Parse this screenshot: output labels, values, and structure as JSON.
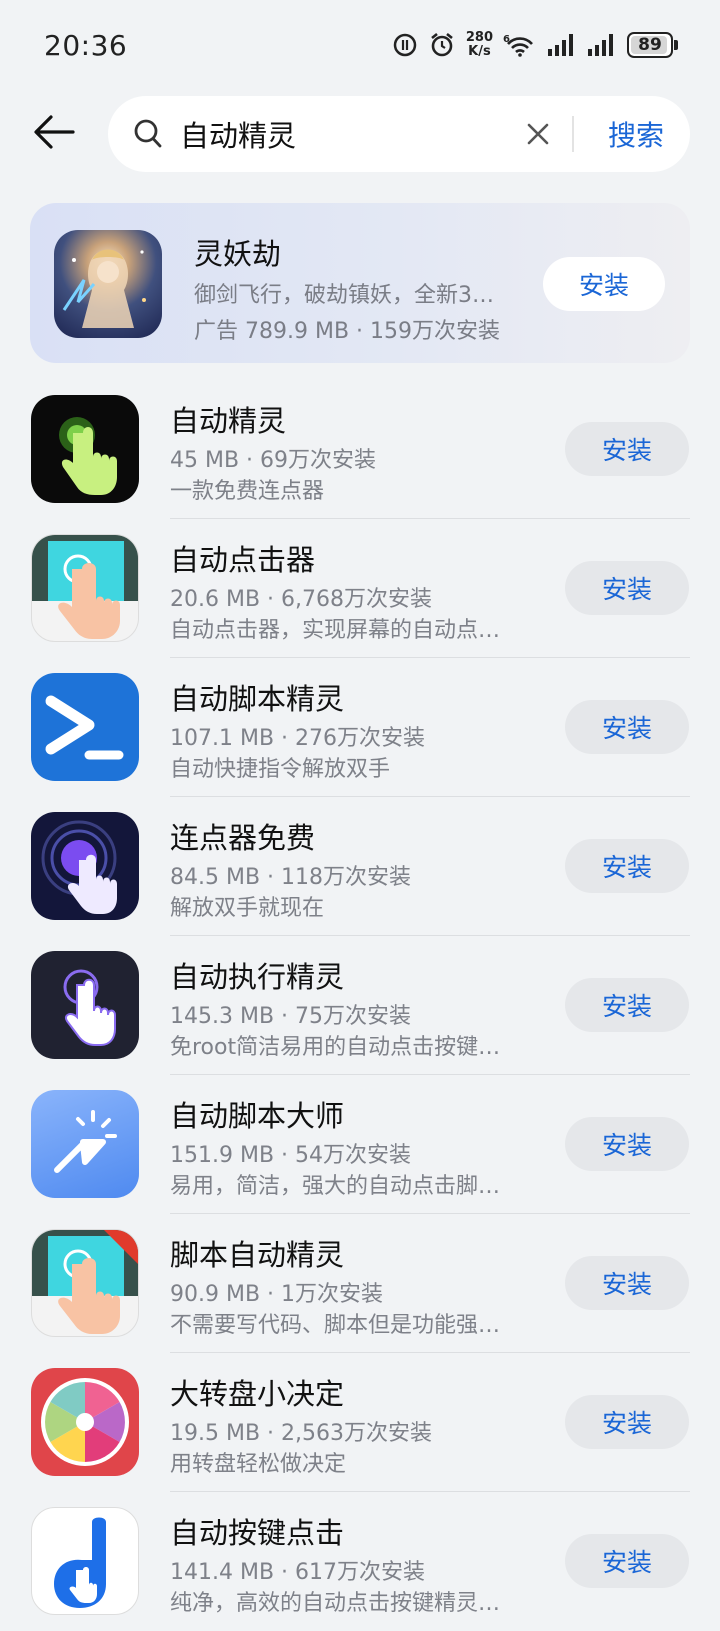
{
  "status_bar": {
    "time": "20:36",
    "net_speed_value": "280",
    "net_speed_unit": "K/s",
    "battery": "89"
  },
  "search": {
    "query": "自动精灵",
    "button_label": "搜索"
  },
  "ad": {
    "title": "灵妖劫",
    "description": "御剑飞行，破劫镇妖，全新3…",
    "meta": "广告 789.9 MB · 159万次安装",
    "install_label": "安装"
  },
  "apps": [
    {
      "name": "自动精灵",
      "meta": "45 MB · 69万次安装",
      "desc": "一款免费连点器",
      "install_label": "安装"
    },
    {
      "name": "自动点击器",
      "meta": "20.6 MB · 6,768万次安装",
      "desc": "自动点击器，实现屏幕的自动点…",
      "install_label": "安装"
    },
    {
      "name": "自动脚本精灵",
      "meta": "107.1 MB · 276万次安装",
      "desc": "自动快捷指令解放双手",
      "install_label": "安装"
    },
    {
      "name": "连点器免费",
      "meta": "84.5 MB · 118万次安装",
      "desc": "解放双手就现在",
      "install_label": "安装"
    },
    {
      "name": "自动执行精灵",
      "meta": "145.3 MB · 75万次安装",
      "desc": "免root简洁易用的自动点击按键…",
      "install_label": "安装"
    },
    {
      "name": "自动脚本大师",
      "meta": "151.9 MB · 54万次安装",
      "desc": "易用，简洁，强大的自动点击脚…",
      "install_label": "安装"
    },
    {
      "name": "脚本自动精灵",
      "meta": "90.9 MB · 1万次安装",
      "desc": "不需要写代码、脚本但是功能强…",
      "install_label": "安装"
    },
    {
      "name": "大转盘小决定",
      "meta": "19.5 MB · 2,563万次安装",
      "desc": "用转盘轻松做决定",
      "install_label": "安装"
    },
    {
      "name": "自动按键点击",
      "meta": "141.4 MB · 617万次安装",
      "desc": "纯净，高效的自动点击按键精灵…",
      "install_label": "安装"
    }
  ],
  "colors": {
    "accent": "#1a66d6",
    "background": "#f1f3f5",
    "install_button_bg": "#e5e7ea"
  }
}
